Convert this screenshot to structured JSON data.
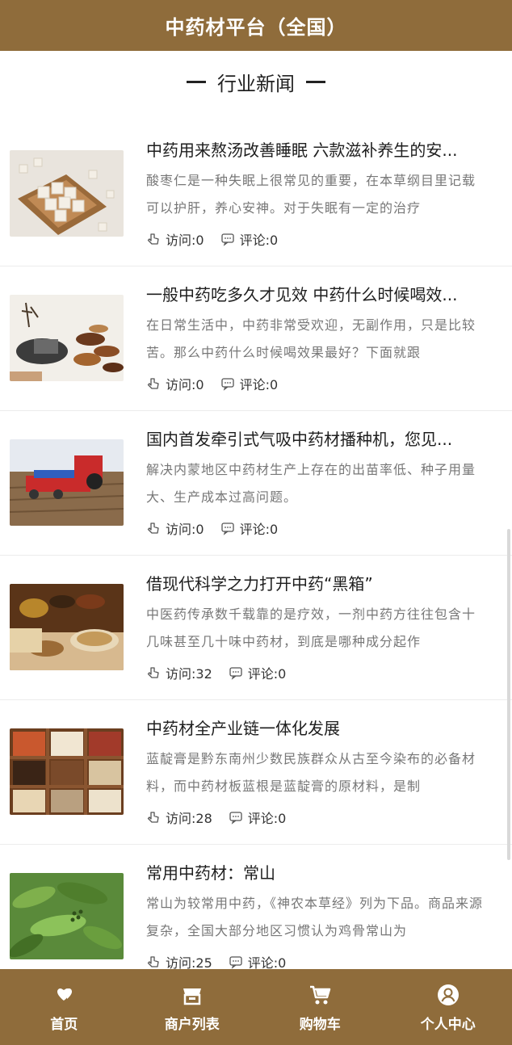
{
  "header": {
    "title": "中药材平台（全国）"
  },
  "section": {
    "title": "行业新闻"
  },
  "colors": {
    "brand": "#8f6c3b"
  },
  "news": [
    {
      "title": "中药用来熬汤改善睡眠 六款滋补养生的安...",
      "desc": "酸枣仁是一种失眠上很常见的重要，在本草纲目里记载可以护肝，养心安神。对于失眠有一定的治疗",
      "visits_label": "访问:0",
      "comments_label": "评论:0",
      "image": "sugar-cubes-tray"
    },
    {
      "title": "一般中药吃多久才见效 中药什么时候喝效...",
      "desc": "在日常生活中，中药非常受欢迎，无副作用，只是比较苦。那么中药什么时候喝效果最好？下面就跟",
      "visits_label": "访问:0",
      "comments_label": "评论:0",
      "image": "herb-bowls"
    },
    {
      "title": "国内首发牵引式气吸中药材播种机，您见...",
      "desc": "解决内蒙地区中药材生产上存在的出苗率低、种子用量大、生产成本过高问题。",
      "visits_label": "访问:0",
      "comments_label": "评论:0",
      "image": "seeding-machine"
    },
    {
      "title": "借现代科学之力打开中药“黑箱”",
      "desc": "中医药传承数千载靠的是疗效，一剂中药方往往包含十几味甚至几十味中药材，到底是哪种成分起作",
      "visits_label": "访问:32",
      "comments_label": "评论:0",
      "image": "herbal-medicine-table"
    },
    {
      "title": "中药材全产业链一体化发展",
      "desc": "蓝靛膏是黔东南州少数民族群众从古至今染布的必备材料，而中药材板蓝根是蓝靛膏的原材料，是制",
      "visits_label": "访问:28",
      "comments_label": "评论:0",
      "image": "herb-grid-box"
    },
    {
      "title": "常用中药材：常山",
      "desc": "常山为较常用中药，《神农本草经》列为下品。商品来源复杂，全国大部分地区习惯认为鸡骨常山为",
      "visits_label": "访问:25",
      "comments_label": "评论:0",
      "image": "green-plant"
    }
  ],
  "tabbar": {
    "items": [
      {
        "label": "首页",
        "icon": "heart-icon"
      },
      {
        "label": "商户列表",
        "icon": "store-icon"
      },
      {
        "label": "购物车",
        "icon": "cart-icon"
      },
      {
        "label": "个人中心",
        "icon": "user-icon"
      }
    ]
  }
}
